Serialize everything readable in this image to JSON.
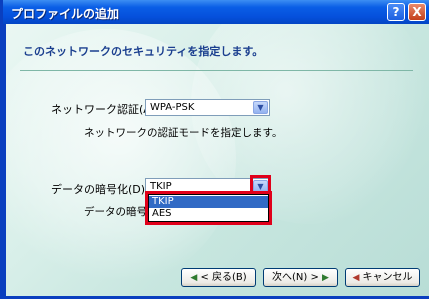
{
  "window": {
    "title": "プロファイルの追加",
    "help_glyph": "?",
    "close_glyph": "X"
  },
  "header": {
    "text": "このネットワークのセキュリティを指定します。"
  },
  "auth": {
    "label": "ネットワーク認証(A):",
    "value": "WPA-PSK",
    "description": "ネットワークの認証モードを指定します。"
  },
  "encryption": {
    "label": "データの暗号化(D):",
    "value": "TKIP",
    "hint_partial": "データの暗号化",
    "options": [
      "TKIP",
      "AES"
    ]
  },
  "buttons": {
    "back": "< 戻る(B)",
    "next": "次へ(N) >",
    "cancel": "キャンセル"
  },
  "icons": {
    "dropdown_arrow": "▼",
    "back_arrow": "◀",
    "next_arrow": "▶",
    "cancel_arrow": "◀"
  },
  "colors": {
    "titlebar": "#0550dc",
    "highlight": "#e0001a",
    "selection": "#316ac5",
    "header_text": "#1b3f8f"
  }
}
